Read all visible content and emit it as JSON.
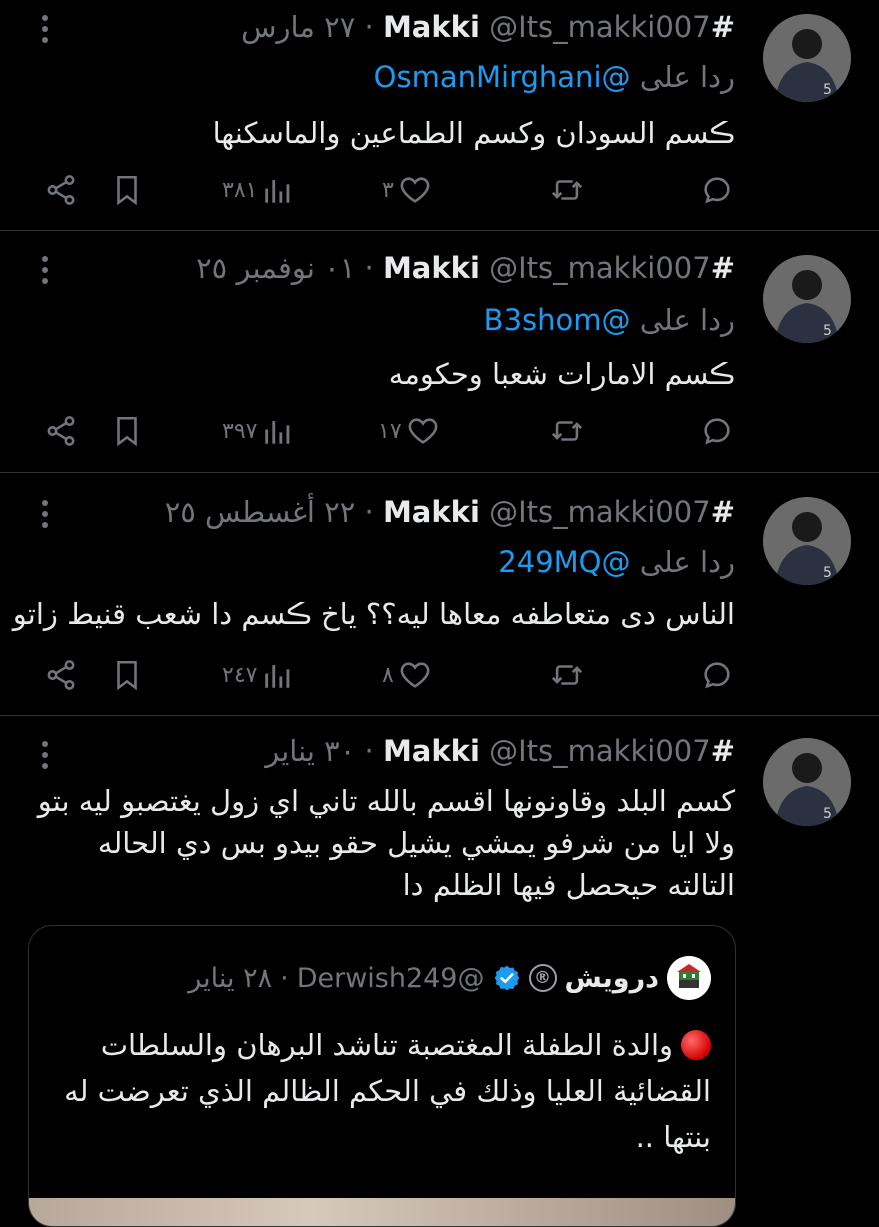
{
  "tweets": [
    {
      "name": "#Makki",
      "handle": "@Its_makki007",
      "date": "٢٧ مارس",
      "reply_prefix": "ردا على",
      "reply_to": "@OsmanMirghani",
      "text": "ڪسم السودان وكسم الطماعين والماسكنها",
      "views": "٣٨١",
      "likes": "٣",
      "retweets": "",
      "replies": ""
    },
    {
      "name": "#Makki",
      "handle": "@Its_makki007",
      "date": "٠١ نوفمبر ٢٥",
      "reply_prefix": "ردا على",
      "reply_to": "@B3shom",
      "text": "ڪسم الامارات شعبا وحكومه",
      "views": "٣٩٧",
      "likes": "١٧",
      "retweets": "",
      "replies": ""
    },
    {
      "name": "#Makki",
      "handle": "@Its_makki007",
      "date": "٢٢ أغسطس ٢٥",
      "reply_prefix": "ردا على",
      "reply_to": "@249MQ",
      "text": "الناس دى متعاطفه معاها ليه؟؟ ياخ ڪسم دا شعب قنيط زاتو",
      "views": "٢٤٧",
      "likes": "٨",
      "retweets": "",
      "replies": ""
    },
    {
      "name": "#Makki",
      "handle": "@Its_makki007",
      "date": "٣٠ يناير",
      "text": "كسم البلد وقاونونها اقسم بالله تاني اي زول يغتصبو ليه بتو ولا ايا من شرفو يمشي يشيل حقو بيدو بس دي الحاله التالته حيحصل فيها الظلم دا"
    }
  ],
  "separator": "·",
  "quote": {
    "name": "درويش",
    "badge": "®",
    "handle": "@Derwish249",
    "date": "٢٨ يناير",
    "text": "والدة الطفلة المغتصبة تناشد البرهان والسلطات القضائية العليا وذلك في الحكم الظالم الذي تعرضت له بنتها .."
  },
  "colors": {
    "accent": "#1d9bf0",
    "muted": "#71767b",
    "text": "#e7e9ea",
    "background": "#000000",
    "divider": "#2f3336"
  }
}
